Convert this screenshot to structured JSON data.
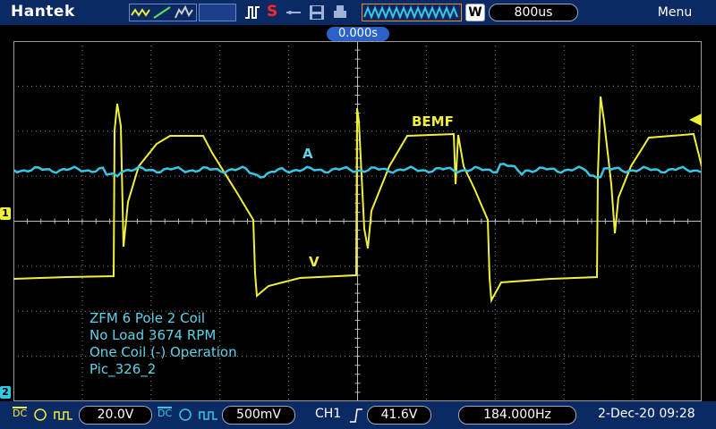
{
  "header": {
    "brand": "Hantek",
    "trigger_mode": "S",
    "time_per_div": "800us",
    "wave_label": "W",
    "menu": "Menu"
  },
  "trigger_position": "0.000s",
  "waveform_labels": {
    "bemf": "BEMF",
    "current": "A",
    "voltage": "V"
  },
  "annotation_lines": [
    "ZFM 6 Pole 2 Coil",
    "No Load 3674 RPM",
    "One Coil (-) Operation",
    "Pic_326_2"
  ],
  "channels": {
    "ch1": {
      "marker": "1",
      "color": "#f0f03a",
      "coupling": "DC",
      "volts_per_div": "20.0V"
    },
    "ch2": {
      "marker": "2",
      "color": "#36c7e6",
      "coupling": "DC",
      "volts_per_div": "500mV"
    }
  },
  "footer": {
    "trigger_source": "CH1",
    "trigger_level": "41.6V",
    "frequency": "184.000Hz",
    "datetime": "2-Dec-20 09:28"
  },
  "icons": [
    "waveform-mode-icon",
    "trigger-edge-icon",
    "print-icon",
    "save-icon",
    "usb-icon",
    "waveform-preview-icon",
    "gnd-icon",
    "rising-edge-icon",
    "trigger-level-marker-icon"
  ]
}
